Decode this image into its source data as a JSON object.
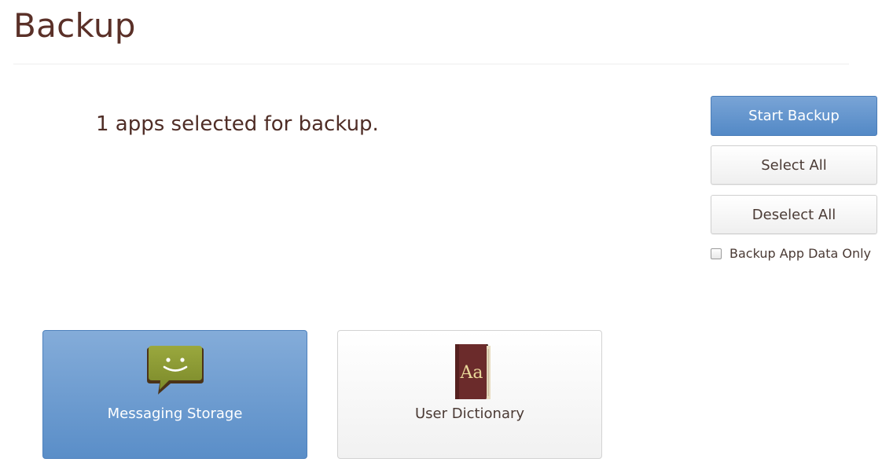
{
  "header": {
    "title": "Backup"
  },
  "status": {
    "text": "1 apps selected for backup."
  },
  "actions": {
    "start_label": "Start Backup",
    "select_all_label": "Select All",
    "deselect_all_label": "Deselect All",
    "app_data_only_label": "Backup App Data Only",
    "app_data_only_checked": false
  },
  "apps": [
    {
      "name": "Messaging Storage",
      "icon": "messaging-icon",
      "selected": true
    },
    {
      "name": "User Dictionary",
      "icon": "dictionary-icon",
      "icon_text": "Aa",
      "selected": false
    }
  ],
  "colors": {
    "primary": "#5a8ec8",
    "title_text": "#5a3028"
  }
}
